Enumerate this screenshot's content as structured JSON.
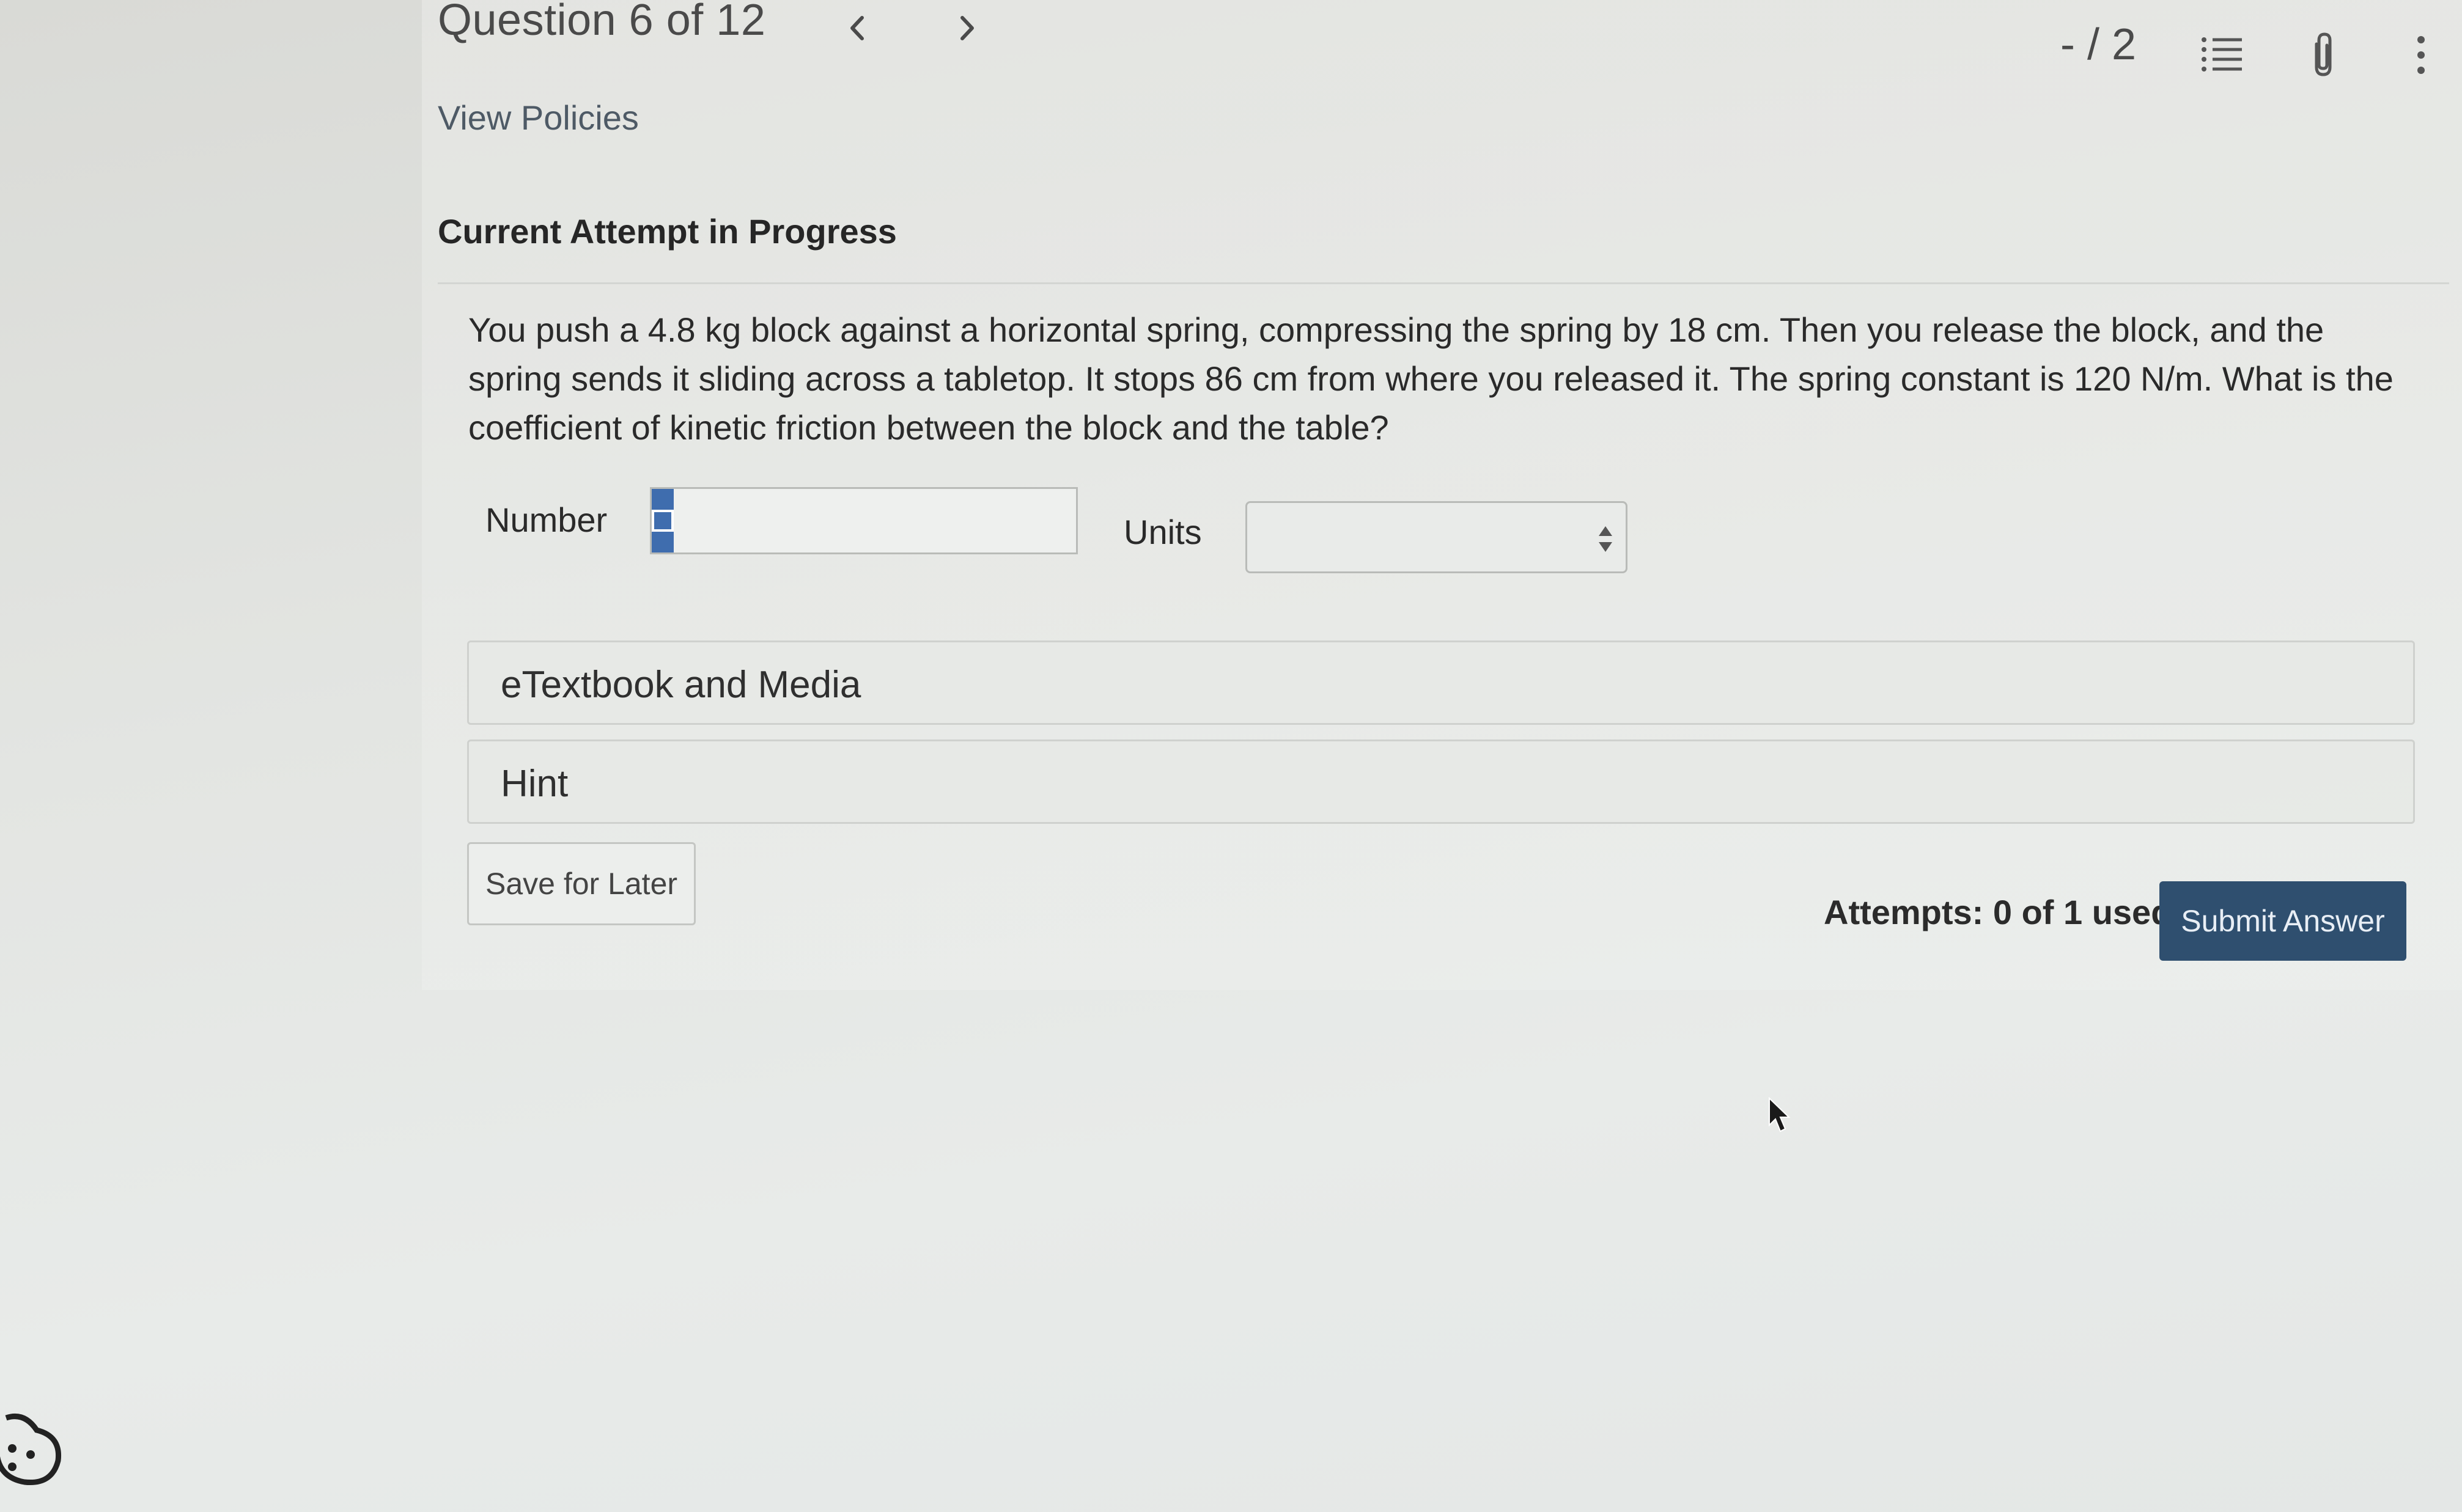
{
  "header": {
    "question_title": "Question 6 of 12",
    "score": "- / 2",
    "icons": [
      "chevron-left-icon",
      "chevron-right-icon",
      "list-icon",
      "paperclip-icon",
      "more-vertical-icon"
    ]
  },
  "links": {
    "view_policies": "View Policies"
  },
  "attempt": {
    "heading": "Current Attempt in Progress"
  },
  "question": {
    "text": "You push a 4.8 kg block against a horizontal spring, compressing the spring by 18 cm. Then you release the block, and the spring sends it sliding across a tabletop. It stops 86 cm from where you released it. The spring constant is 120 N/m. What is the coefficient of kinetic friction between the block and the table?"
  },
  "answer": {
    "number_label": "Number",
    "number_value": "",
    "units_label": "Units",
    "units_value": ""
  },
  "accordions": {
    "etextbook": "eTextbook and Media",
    "hint": "Hint"
  },
  "footer": {
    "save_label": "Save for Later",
    "attempts": "Attempts: 0 of 1 used",
    "submit_label": "Submit Answer"
  },
  "colors": {
    "accent_blue": "#3f6dae",
    "submit_bg": "#2f4f6f"
  }
}
